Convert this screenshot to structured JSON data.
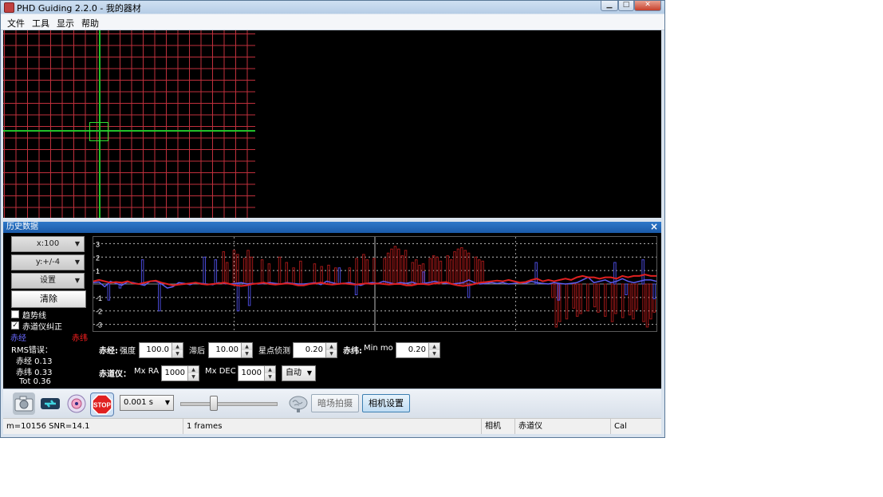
{
  "window": {
    "title": "PHD Guiding 2.2.0 - 我的器材"
  },
  "menu": [
    "文件",
    "工具",
    "显示",
    "帮助"
  ],
  "history": {
    "title": "历史数据",
    "x_scale": "x:100",
    "y_scale": "y:+/-4",
    "settings": "设置",
    "clear": "清除",
    "trendlines": "趋势线",
    "ra_correct": "赤道仪纠正",
    "legend_ra": "赤经",
    "legend_dec": "赤纬",
    "rms_title": "RMS错误：",
    "rms_ra": "赤经 0.13",
    "rms_dec": "赤纬 0.33",
    "rms_tot": "Tot 0.36"
  },
  "chart_data": {
    "type": "line",
    "y_ticks": [
      "3",
      "2",
      "1",
      "-1",
      "-2",
      "-3"
    ],
    "ylim": [
      -3.5,
      3.5
    ],
    "x_count": 100,
    "series": [
      {
        "name": "赤经",
        "color": "#5c5cf0",
        "values": [
          0.1,
          0.15,
          -0.2,
          0.2,
          0.05,
          -0.1,
          0.15,
          0.1,
          0.0,
          -0.1,
          0.2,
          0.2,
          0.0,
          -0.3,
          -0.2,
          0.1,
          0.05,
          -0.05,
          0.1,
          0.05,
          0.0,
          -0.05,
          0.1,
          0.05,
          0.0,
          0.05,
          0.1,
          0.0,
          0.05,
          0.0,
          0.05,
          0.1,
          0.05,
          0.0,
          0.1,
          0.05,
          0.0,
          0.0,
          0.05,
          0.1,
          -0.05,
          0.2,
          0.1,
          0.0,
          0.05,
          0.1,
          0.0,
          -0.1,
          0.05,
          0.1,
          0.05,
          0.2,
          0.1,
          0.0,
          0.1,
          0.05,
          0.15,
          0.0,
          0.05,
          0.1,
          0.2,
          0.1,
          0.05,
          0.0,
          0.05,
          0.1,
          0.3,
          0.1,
          0.0,
          0.05,
          0.1,
          0.05,
          0.1,
          0.0,
          0.05,
          0.1,
          0.05,
          0.2,
          0.1,
          0.05,
          0.0,
          0.1,
          0.05,
          0.0,
          0.05,
          0.1,
          0.3,
          0.5,
          0.1,
          0.2,
          0.3,
          0.1,
          0.2,
          0.4,
          0.2,
          0.1,
          0.2,
          0.3,
          0.3,
          0.2
        ]
      },
      {
        "name": "赤纬",
        "color": "#e02020",
        "values": [
          0.2,
          0.3,
          0.2,
          0.1,
          0.15,
          0.1,
          0.2,
          0.05,
          0.0,
          0.1,
          0.2,
          0.25,
          0.1,
          0.0,
          -0.1,
          -0.05,
          0.0,
          0.05,
          0.1,
          0.0,
          -0.05,
          0.0,
          0.05,
          0.1,
          0.0,
          -0.1,
          -0.15,
          -0.1,
          0.0,
          0.05,
          0.1,
          0.0,
          -0.05,
          0.0,
          0.05,
          0.0,
          -0.1,
          -0.1,
          0.0,
          0.05,
          0.1,
          0.0,
          -0.05,
          0.0,
          0.05,
          0.0,
          -0.05,
          0.0,
          0.05,
          0.0,
          0.05,
          0.0,
          -0.05,
          0.0,
          0.0,
          -0.1,
          -0.1,
          0.0,
          0.0,
          -0.05,
          0.05,
          0.1,
          0.15,
          0.0,
          -0.1,
          -0.15,
          -0.1,
          0.0,
          0.1,
          0.15,
          0.2,
          0.25,
          0.2,
          0.3,
          0.2,
          0.1,
          0.15,
          0.3,
          0.4,
          0.2,
          0.3,
          0.2,
          0.3,
          0.4,
          0.3,
          0.5,
          0.6,
          0.5,
          0.5,
          0.4,
          0.5,
          0.5,
          0.4,
          0.6,
          0.5,
          0.6,
          0.6,
          0.7,
          0.6,
          0.6
        ]
      }
    ],
    "ra_pulses": [
      [
        2,
        -1.2
      ],
      [
        4,
        -0.3
      ],
      [
        8,
        1.8
      ],
      [
        11,
        -2.0
      ],
      [
        19,
        2.0
      ],
      [
        21,
        1.8
      ],
      [
        25,
        -2.0
      ],
      [
        27,
        -1.6
      ],
      [
        43,
        1.2
      ],
      [
        46,
        -0.8
      ],
      [
        58,
        0.9
      ],
      [
        66,
        -1.0
      ],
      [
        78,
        1.6
      ],
      [
        82,
        -1.2
      ],
      [
        92,
        1.6
      ],
      [
        94,
        -0.8
      ],
      [
        97,
        1.8
      ],
      [
        99,
        -1.1
      ]
    ],
    "dec_pulses": [
      [
        36,
        2.4
      ],
      [
        37,
        1.6
      ],
      [
        39,
        2.5
      ],
      [
        40,
        2.2
      ],
      [
        42,
        1.9
      ],
      [
        43,
        2.5
      ],
      [
        44,
        2.0
      ],
      [
        47,
        1.8
      ],
      [
        49,
        1.5
      ],
      [
        52,
        2.0
      ],
      [
        54,
        1.6
      ],
      [
        56,
        1.2
      ],
      [
        58,
        1.7
      ],
      [
        62,
        1.5
      ],
      [
        64,
        1.3
      ],
      [
        66,
        1.4
      ],
      [
        68,
        1.2
      ],
      [
        72,
        1.2
      ],
      [
        74,
        1.9
      ],
      [
        76,
        2.2
      ],
      [
        77,
        1.8
      ],
      [
        79,
        1.9
      ],
      [
        82,
        1.9
      ],
      [
        83,
        2.3
      ],
      [
        84,
        2.6
      ],
      [
        85,
        2.8
      ],
      [
        86,
        2.6
      ],
      [
        87,
        2.1
      ],
      [
        88,
        2.5
      ],
      [
        90,
        1.6
      ],
      [
        91,
        1.8
      ],
      [
        92,
        1.4
      ],
      [
        93,
        1.5
      ],
      [
        95,
        1.9
      ],
      [
        96,
        2.1
      ],
      [
        97,
        2.0
      ],
      [
        98,
        1.7
      ],
      [
        100,
        2.1
      ],
      [
        101,
        1.8
      ],
      [
        102,
        2.4
      ],
      [
        103,
        2.6
      ],
      [
        104,
        2.7
      ],
      [
        105,
        2.5
      ],
      [
        106,
        2.3
      ],
      [
        108,
        2.0
      ],
      [
        109,
        1.8
      ],
      [
        110,
        1.7
      ],
      [
        130,
        -1.0
      ],
      [
        131,
        -3.2
      ],
      [
        132,
        -2.8
      ],
      [
        134,
        -2.6
      ],
      [
        136,
        -1.8
      ],
      [
        137,
        -2.4
      ],
      [
        138,
        -2.2
      ],
      [
        140,
        -2.0
      ],
      [
        142,
        -1.7
      ],
      [
        143,
        -2.1
      ],
      [
        145,
        -2.4
      ],
      [
        147,
        -2.8
      ],
      [
        148,
        -2.2
      ],
      [
        150,
        -2.5
      ],
      [
        152,
        -2.3
      ],
      [
        153,
        -2.6
      ],
      [
        154,
        -1.9
      ],
      [
        156,
        -2.8
      ],
      [
        157,
        -3.2
      ],
      [
        158,
        -2.6
      ],
      [
        159,
        -2.1
      ]
    ]
  },
  "params": {
    "ra_label": "赤经:",
    "aggr_label": "强度",
    "aggr_val": "100.0",
    "hyst_label": "滞后",
    "hyst_val": "10.00",
    "minmo_label": "星点侦测",
    "minmo_val": "0.20",
    "dec_label": "赤纬:",
    "dec_minmo_label": "Min mo",
    "dec_minmo_val": "0.20",
    "mount_label": "赤道仪：",
    "mxra_label": "Mx RA",
    "mxra_val": "1000",
    "mxdec_label": "Mx DEC",
    "mxdec_val": "1000",
    "mode": "自动"
  },
  "toolbar": {
    "exposure": "0.001 s",
    "dark": "暗场拍摄",
    "cam_settings": "相机设置"
  },
  "status": {
    "stats": "m=10156 SNR=14.1",
    "frames": "1 frames",
    "camera": "相机",
    "mount": "赤道仪",
    "cal": "Cal"
  }
}
